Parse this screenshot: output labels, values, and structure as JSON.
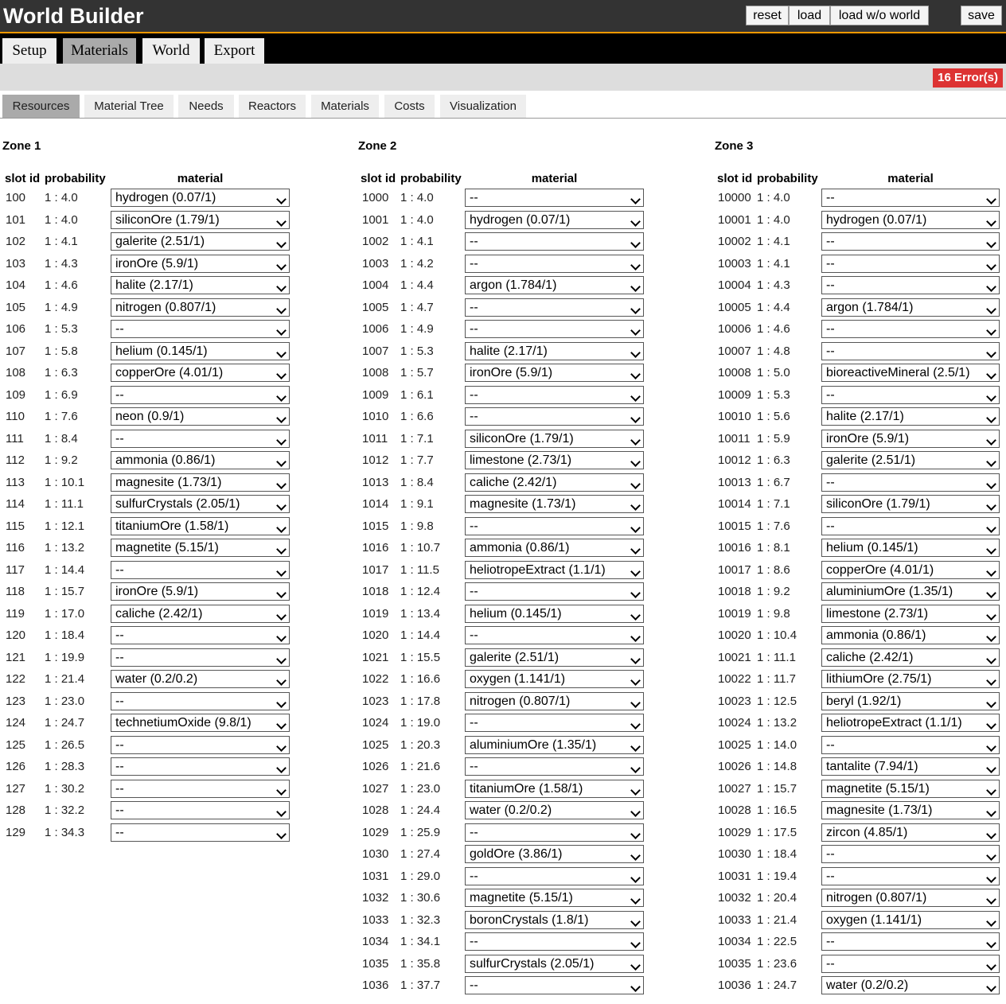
{
  "app": {
    "title": "World Builder"
  },
  "topbar": {
    "reset": "reset",
    "load": "load",
    "load_without_world": "load w/o world",
    "save": "save"
  },
  "main_tabs": [
    "Setup",
    "Materials",
    "World",
    "Export"
  ],
  "active_main_tab": "Materials",
  "errors": {
    "label": "16 Error(s)"
  },
  "sub_tabs": [
    "Resources",
    "Material Tree",
    "Needs",
    "Reactors",
    "Materials",
    "Costs",
    "Visualization"
  ],
  "active_sub_tab": "Resources",
  "columns": {
    "slot_id": "slot id",
    "probability": "probability",
    "material": "material"
  },
  "zones": [
    {
      "name": "Zone 1",
      "rows": [
        {
          "slot": "100",
          "prob": "1 : 4.0",
          "material": "hydrogen (0.07/1)"
        },
        {
          "slot": "101",
          "prob": "1 : 4.0",
          "material": "siliconOre (1.79/1)"
        },
        {
          "slot": "102",
          "prob": "1 : 4.1",
          "material": "galerite (2.51/1)"
        },
        {
          "slot": "103",
          "prob": "1 : 4.3",
          "material": "ironOre (5.9/1)"
        },
        {
          "slot": "104",
          "prob": "1 : 4.6",
          "material": "halite (2.17/1)"
        },
        {
          "slot": "105",
          "prob": "1 : 4.9",
          "material": "nitrogen (0.807/1)"
        },
        {
          "slot": "106",
          "prob": "1 : 5.3",
          "material": "--"
        },
        {
          "slot": "107",
          "prob": "1 : 5.8",
          "material": "helium (0.145/1)"
        },
        {
          "slot": "108",
          "prob": "1 : 6.3",
          "material": "copperOre (4.01/1)"
        },
        {
          "slot": "109",
          "prob": "1 : 6.9",
          "material": "--"
        },
        {
          "slot": "110",
          "prob": "1 : 7.6",
          "material": "neon (0.9/1)"
        },
        {
          "slot": "111",
          "prob": "1 : 8.4",
          "material": "--"
        },
        {
          "slot": "112",
          "prob": "1 : 9.2",
          "material": "ammonia (0.86/1)"
        },
        {
          "slot": "113",
          "prob": "1 : 10.1",
          "material": "magnesite (1.73/1)"
        },
        {
          "slot": "114",
          "prob": "1 : 11.1",
          "material": "sulfurCrystals (2.05/1)"
        },
        {
          "slot": "115",
          "prob": "1 : 12.1",
          "material": "titaniumOre (1.58/1)"
        },
        {
          "slot": "116",
          "prob": "1 : 13.2",
          "material": "magnetite (5.15/1)"
        },
        {
          "slot": "117",
          "prob": "1 : 14.4",
          "material": "--"
        },
        {
          "slot": "118",
          "prob": "1 : 15.7",
          "material": "ironOre (5.9/1)"
        },
        {
          "slot": "119",
          "prob": "1 : 17.0",
          "material": "caliche (2.42/1)"
        },
        {
          "slot": "120",
          "prob": "1 : 18.4",
          "material": "--"
        },
        {
          "slot": "121",
          "prob": "1 : 19.9",
          "material": "--"
        },
        {
          "slot": "122",
          "prob": "1 : 21.4",
          "material": "water (0.2/0.2)"
        },
        {
          "slot": "123",
          "prob": "1 : 23.0",
          "material": "--"
        },
        {
          "slot": "124",
          "prob": "1 : 24.7",
          "material": "technetiumOxide (9.8/1)"
        },
        {
          "slot": "125",
          "prob": "1 : 26.5",
          "material": "--"
        },
        {
          "slot": "126",
          "prob": "1 : 28.3",
          "material": "--"
        },
        {
          "slot": "127",
          "prob": "1 : 30.2",
          "material": "--"
        },
        {
          "slot": "128",
          "prob": "1 : 32.2",
          "material": "--"
        },
        {
          "slot": "129",
          "prob": "1 : 34.3",
          "material": "--"
        }
      ]
    },
    {
      "name": "Zone 2",
      "rows": [
        {
          "slot": "1000",
          "prob": "1 : 4.0",
          "material": "--"
        },
        {
          "slot": "1001",
          "prob": "1 : 4.0",
          "material": "hydrogen (0.07/1)"
        },
        {
          "slot": "1002",
          "prob": "1 : 4.1",
          "material": "--"
        },
        {
          "slot": "1003",
          "prob": "1 : 4.2",
          "material": "--"
        },
        {
          "slot": "1004",
          "prob": "1 : 4.4",
          "material": "argon (1.784/1)"
        },
        {
          "slot": "1005",
          "prob": "1 : 4.7",
          "material": "--"
        },
        {
          "slot": "1006",
          "prob": "1 : 4.9",
          "material": "--"
        },
        {
          "slot": "1007",
          "prob": "1 : 5.3",
          "material": "halite (2.17/1)"
        },
        {
          "slot": "1008",
          "prob": "1 : 5.7",
          "material": "ironOre (5.9/1)"
        },
        {
          "slot": "1009",
          "prob": "1 : 6.1",
          "material": "--"
        },
        {
          "slot": "1010",
          "prob": "1 : 6.6",
          "material": "--"
        },
        {
          "slot": "1011",
          "prob": "1 : 7.1",
          "material": "siliconOre (1.79/1)"
        },
        {
          "slot": "1012",
          "prob": "1 : 7.7",
          "material": "limestone (2.73/1)"
        },
        {
          "slot": "1013",
          "prob": "1 : 8.4",
          "material": "caliche (2.42/1)"
        },
        {
          "slot": "1014",
          "prob": "1 : 9.1",
          "material": "magnesite (1.73/1)"
        },
        {
          "slot": "1015",
          "prob": "1 : 9.8",
          "material": "--"
        },
        {
          "slot": "1016",
          "prob": "1 : 10.7",
          "material": "ammonia (0.86/1)"
        },
        {
          "slot": "1017",
          "prob": "1 : 11.5",
          "material": "heliotropeExtract (1.1/1)"
        },
        {
          "slot": "1018",
          "prob": "1 : 12.4",
          "material": "--"
        },
        {
          "slot": "1019",
          "prob": "1 : 13.4",
          "material": "helium (0.145/1)"
        },
        {
          "slot": "1020",
          "prob": "1 : 14.4",
          "material": "--"
        },
        {
          "slot": "1021",
          "prob": "1 : 15.5",
          "material": "galerite (2.51/1)"
        },
        {
          "slot": "1022",
          "prob": "1 : 16.6",
          "material": "oxygen (1.141/1)"
        },
        {
          "slot": "1023",
          "prob": "1 : 17.8",
          "material": "nitrogen (0.807/1)"
        },
        {
          "slot": "1024",
          "prob": "1 : 19.0",
          "material": "--"
        },
        {
          "slot": "1025",
          "prob": "1 : 20.3",
          "material": "aluminiumOre (1.35/1)"
        },
        {
          "slot": "1026",
          "prob": "1 : 21.6",
          "material": "--"
        },
        {
          "slot": "1027",
          "prob": "1 : 23.0",
          "material": "titaniumOre (1.58/1)"
        },
        {
          "slot": "1028",
          "prob": "1 : 24.4",
          "material": "water (0.2/0.2)"
        },
        {
          "slot": "1029",
          "prob": "1 : 25.9",
          "material": "--"
        },
        {
          "slot": "1030",
          "prob": "1 : 27.4",
          "material": "goldOre (3.86/1)"
        },
        {
          "slot": "1031",
          "prob": "1 : 29.0",
          "material": "--"
        },
        {
          "slot": "1032",
          "prob": "1 : 30.6",
          "material": "magnetite (5.15/1)"
        },
        {
          "slot": "1033",
          "prob": "1 : 32.3",
          "material": "boronCrystals (1.8/1)"
        },
        {
          "slot": "1034",
          "prob": "1 : 34.1",
          "material": "--"
        },
        {
          "slot": "1035",
          "prob": "1 : 35.8",
          "material": "sulfurCrystals (2.05/1)"
        },
        {
          "slot": "1036",
          "prob": "1 : 37.7",
          "material": "--"
        }
      ]
    },
    {
      "name": "Zone 3",
      "rows": [
        {
          "slot": "10000",
          "prob": "1 : 4.0",
          "material": "--"
        },
        {
          "slot": "10001",
          "prob": "1 : 4.0",
          "material": "hydrogen (0.07/1)"
        },
        {
          "slot": "10002",
          "prob": "1 : 4.1",
          "material": "--"
        },
        {
          "slot": "10003",
          "prob": "1 : 4.1",
          "material": "--"
        },
        {
          "slot": "10004",
          "prob": "1 : 4.3",
          "material": "--"
        },
        {
          "slot": "10005",
          "prob": "1 : 4.4",
          "material": "argon (1.784/1)"
        },
        {
          "slot": "10006",
          "prob": "1 : 4.6",
          "material": "--"
        },
        {
          "slot": "10007",
          "prob": "1 : 4.8",
          "material": "--"
        },
        {
          "slot": "10008",
          "prob": "1 : 5.0",
          "material": "bioreactiveMineral (2.5/1)"
        },
        {
          "slot": "10009",
          "prob": "1 : 5.3",
          "material": "--"
        },
        {
          "slot": "10010",
          "prob": "1 : 5.6",
          "material": "halite (2.17/1)"
        },
        {
          "slot": "10011",
          "prob": "1 : 5.9",
          "material": "ironOre (5.9/1)"
        },
        {
          "slot": "10012",
          "prob": "1 : 6.3",
          "material": "galerite (2.51/1)"
        },
        {
          "slot": "10013",
          "prob": "1 : 6.7",
          "material": "--"
        },
        {
          "slot": "10014",
          "prob": "1 : 7.1",
          "material": "siliconOre (1.79/1)"
        },
        {
          "slot": "10015",
          "prob": "1 : 7.6",
          "material": "--"
        },
        {
          "slot": "10016",
          "prob": "1 : 8.1",
          "material": "helium (0.145/1)"
        },
        {
          "slot": "10017",
          "prob": "1 : 8.6",
          "material": "copperOre (4.01/1)"
        },
        {
          "slot": "10018",
          "prob": "1 : 9.2",
          "material": "aluminiumOre (1.35/1)"
        },
        {
          "slot": "10019",
          "prob": "1 : 9.8",
          "material": "limestone (2.73/1)"
        },
        {
          "slot": "10020",
          "prob": "1 : 10.4",
          "material": "ammonia (0.86/1)"
        },
        {
          "slot": "10021",
          "prob": "1 : 11.1",
          "material": "caliche (2.42/1)"
        },
        {
          "slot": "10022",
          "prob": "1 : 11.7",
          "material": "lithiumOre (2.75/1)"
        },
        {
          "slot": "10023",
          "prob": "1 : 12.5",
          "material": "beryl (1.92/1)"
        },
        {
          "slot": "10024",
          "prob": "1 : 13.2",
          "material": "heliotropeExtract (1.1/1)"
        },
        {
          "slot": "10025",
          "prob": "1 : 14.0",
          "material": "--"
        },
        {
          "slot": "10026",
          "prob": "1 : 14.8",
          "material": "tantalite (7.94/1)"
        },
        {
          "slot": "10027",
          "prob": "1 : 15.7",
          "material": "magnetite (5.15/1)"
        },
        {
          "slot": "10028",
          "prob": "1 : 16.5",
          "material": "magnesite (1.73/1)"
        },
        {
          "slot": "10029",
          "prob": "1 : 17.5",
          "material": "zircon (4.85/1)"
        },
        {
          "slot": "10030",
          "prob": "1 : 18.4",
          "material": "--"
        },
        {
          "slot": "10031",
          "prob": "1 : 19.4",
          "material": "--"
        },
        {
          "slot": "10032",
          "prob": "1 : 20.4",
          "material": "nitrogen (0.807/1)"
        },
        {
          "slot": "10033",
          "prob": "1 : 21.4",
          "material": "oxygen (1.141/1)"
        },
        {
          "slot": "10034",
          "prob": "1 : 22.5",
          "material": "--"
        },
        {
          "slot": "10035",
          "prob": "1 : 23.6",
          "material": "--"
        },
        {
          "slot": "10036",
          "prob": "1 : 24.7",
          "material": "water (0.2/0.2)"
        }
      ]
    }
  ]
}
